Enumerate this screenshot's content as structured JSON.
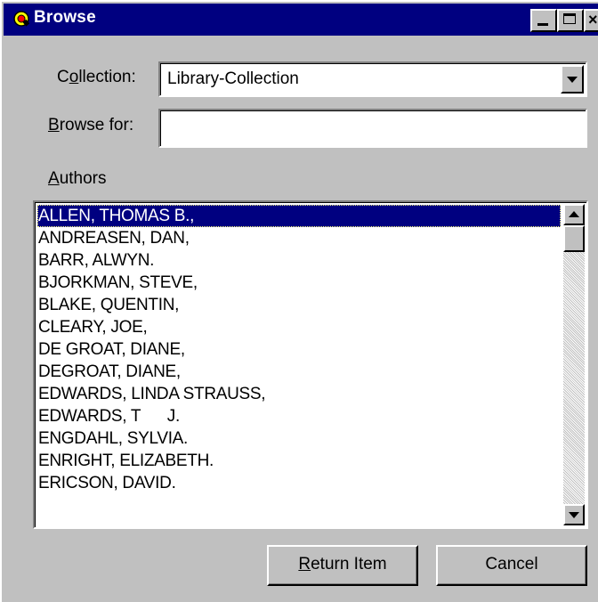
{
  "window": {
    "title": "Browse",
    "close_glyph": "×"
  },
  "collection": {
    "label_pre": "C",
    "label_ul": "o",
    "label_post": "llection:",
    "selected": "Library-Collection"
  },
  "browse_for": {
    "label_ul": "B",
    "label_post": "rowse for:",
    "value": ""
  },
  "list": {
    "label_ul": "A",
    "label_post": "uthors",
    "items": [
      "ALLEN, THOMAS B.,",
      "ANDREASEN, DAN,",
      "BARR, ALWYN.",
      "BJORKMAN, STEVE,",
      "BLAKE, QUENTIN,",
      "CLEARY, JOE,",
      "DE GROAT, DIANE,",
      "DEGROAT, DIANE,",
      "EDWARDS, LINDA STRAUSS,",
      "EDWARDS, T      J.",
      "ENGDAHL, SYLVIA.",
      "ENRIGHT, ELIZABETH.",
      "ERICSON, DAVID."
    ],
    "selected_index": 0
  },
  "buttons": {
    "return_ul": "R",
    "return_post": "eturn Item",
    "cancel": "Cancel"
  },
  "colors": {
    "face": "#c0c0c0",
    "titlebar": "#000080",
    "selection": "#000080"
  }
}
